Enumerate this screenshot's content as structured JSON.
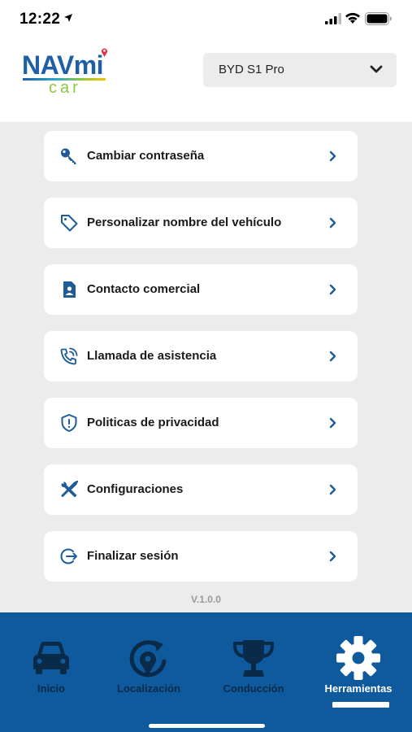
{
  "status_bar": {
    "time": "12:22"
  },
  "header": {
    "logo_text": "NAVmi",
    "logo_subtext": "car",
    "vehicle_selected": "BYD S1 Pro"
  },
  "menu": {
    "items": [
      {
        "label": "Cambiar contraseña",
        "icon": "key-icon"
      },
      {
        "label": "Personalizar nombre del vehículo",
        "icon": "tag-icon"
      },
      {
        "label": "Contacto comercial",
        "icon": "contact-card-icon"
      },
      {
        "label": "Llamada de asistencia",
        "icon": "phone-call-icon"
      },
      {
        "label": "Politicas de privacidad",
        "icon": "shield-alert-icon"
      },
      {
        "label": "Configuraciones",
        "icon": "tools-icon"
      },
      {
        "label": "Finalizar sesión",
        "icon": "logout-icon"
      }
    ],
    "version": "V.1.0.0"
  },
  "bottom_nav": {
    "items": [
      {
        "label": "Inicio",
        "icon": "car-icon"
      },
      {
        "label": "Localización",
        "icon": "location-refresh-icon"
      },
      {
        "label": "Conducción",
        "icon": "trophy-icon"
      },
      {
        "label": "Herramientas",
        "icon": "gear-icon"
      }
    ],
    "active": "Herramientas"
  },
  "colors": {
    "primary": "#0f5a9c",
    "icon": "#1e5c98",
    "inactive_nav": "#0a2a4a",
    "background": "#ececec"
  }
}
